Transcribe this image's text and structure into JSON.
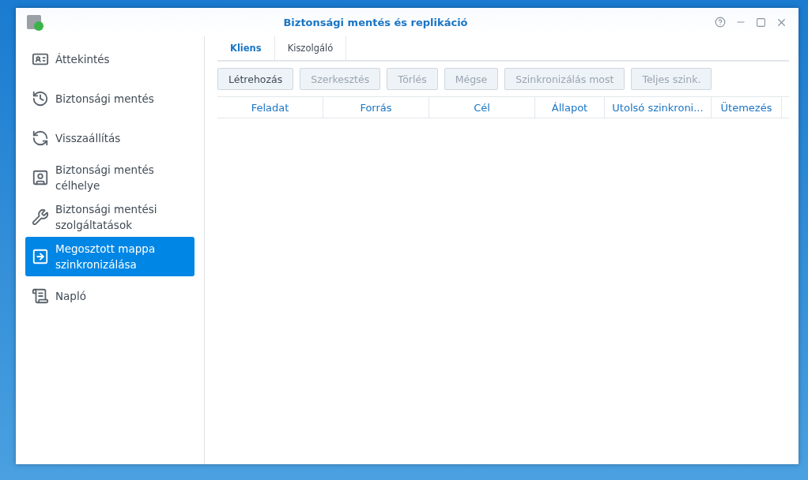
{
  "window": {
    "title": "Biztonsági mentés és replikáció"
  },
  "sidebar": {
    "items": [
      {
        "label": "Áttekintés",
        "kind": "overview",
        "selected": false
      },
      {
        "label": "Biztonsági mentés",
        "kind": "backup",
        "selected": false
      },
      {
        "label": "Visszaállítás",
        "kind": "restore",
        "selected": false
      },
      {
        "label": "Biztonsági mentés célhelye",
        "kind": "destination",
        "selected": false
      },
      {
        "label": "Biztonsági mentési szolgáltatások",
        "kind": "services",
        "selected": false
      },
      {
        "label": "Megosztott mappa szinkronizálása",
        "kind": "sync",
        "selected": true
      },
      {
        "label": "Napló",
        "kind": "log",
        "selected": false
      }
    ]
  },
  "tabs": [
    {
      "label": "Kliens",
      "selected": true
    },
    {
      "label": "Kiszolgáló",
      "selected": false
    }
  ],
  "toolbar": {
    "buttons": [
      {
        "label": "Létrehozás",
        "disabled": false
      },
      {
        "label": "Szerkesztés",
        "disabled": true
      },
      {
        "label": "Törlés",
        "disabled": true
      },
      {
        "label": "Mégse",
        "disabled": true
      },
      {
        "label": "Szinkronizálás most",
        "disabled": true
      },
      {
        "label": "Teljes szink.",
        "disabled": true
      }
    ]
  },
  "table": {
    "columns": [
      "Feladat",
      "Forrás",
      "Cél",
      "Állapot",
      "Utolsó szinkroni...",
      "Ütemezés"
    ]
  }
}
